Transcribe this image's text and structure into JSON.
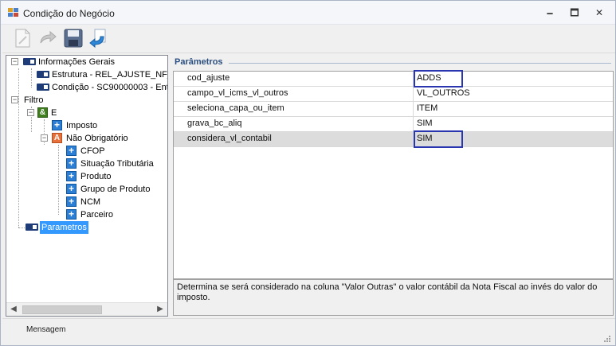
{
  "window": {
    "title": "Condição do Negócio",
    "min_glyph": "🗕",
    "max_glyph": "🗖",
    "close_glyph": "✕"
  },
  "toolbar": {
    "buttons": [
      {
        "icon": "new-document-icon"
      },
      {
        "icon": "redo-arrow-icon"
      },
      {
        "icon": "save-floppy-icon"
      },
      {
        "icon": "return-arrow-icon"
      }
    ]
  },
  "tree": {
    "informacoes_gerais": "Informações Gerais",
    "estrutura": "Estrutura - REL_AJUSTE_NF_",
    "condicao": "Condição - SC90000003 - Ent",
    "filtro": "Filtro",
    "e_node": "E",
    "e_icon_glyph": "&",
    "imposto": "Imposto",
    "nao_obrigatorio": "Não Obrigatório",
    "a_icon_glyph": "A",
    "cfop": "CFOP",
    "situacao_tributaria": "Situação Tributária",
    "produto": "Produto",
    "grupo_produto": "Grupo de Produto",
    "ncm": "NCM",
    "parceiro": "Parceiro",
    "parametros": "Parametros",
    "plus_glyph": "+",
    "collapse_glyph": "−"
  },
  "parameters": {
    "section_title": "Parâmetros",
    "rows": [
      {
        "key": "cod_ajuste",
        "value": "ADDS"
      },
      {
        "key": "campo_vl_icms_vl_outros",
        "value": "VL_OUTROS"
      },
      {
        "key": "seleciona_capa_ou_item",
        "value": "ITEM"
      },
      {
        "key": "grava_bc_aliq",
        "value": "SIM"
      },
      {
        "key": "considera_vl_contabil",
        "value": "SIM"
      }
    ],
    "selected_row": 4,
    "description": "Determina se será considerado na coluna \"Valor Outras\" o valor contábil da Nota Fiscal ao invés do valor do imposto."
  },
  "status": {
    "message": "Mensagem"
  },
  "colors": {
    "highlight_box": "#2a35b0",
    "selection": "#3399ff",
    "section_title": "#2b4f80"
  }
}
